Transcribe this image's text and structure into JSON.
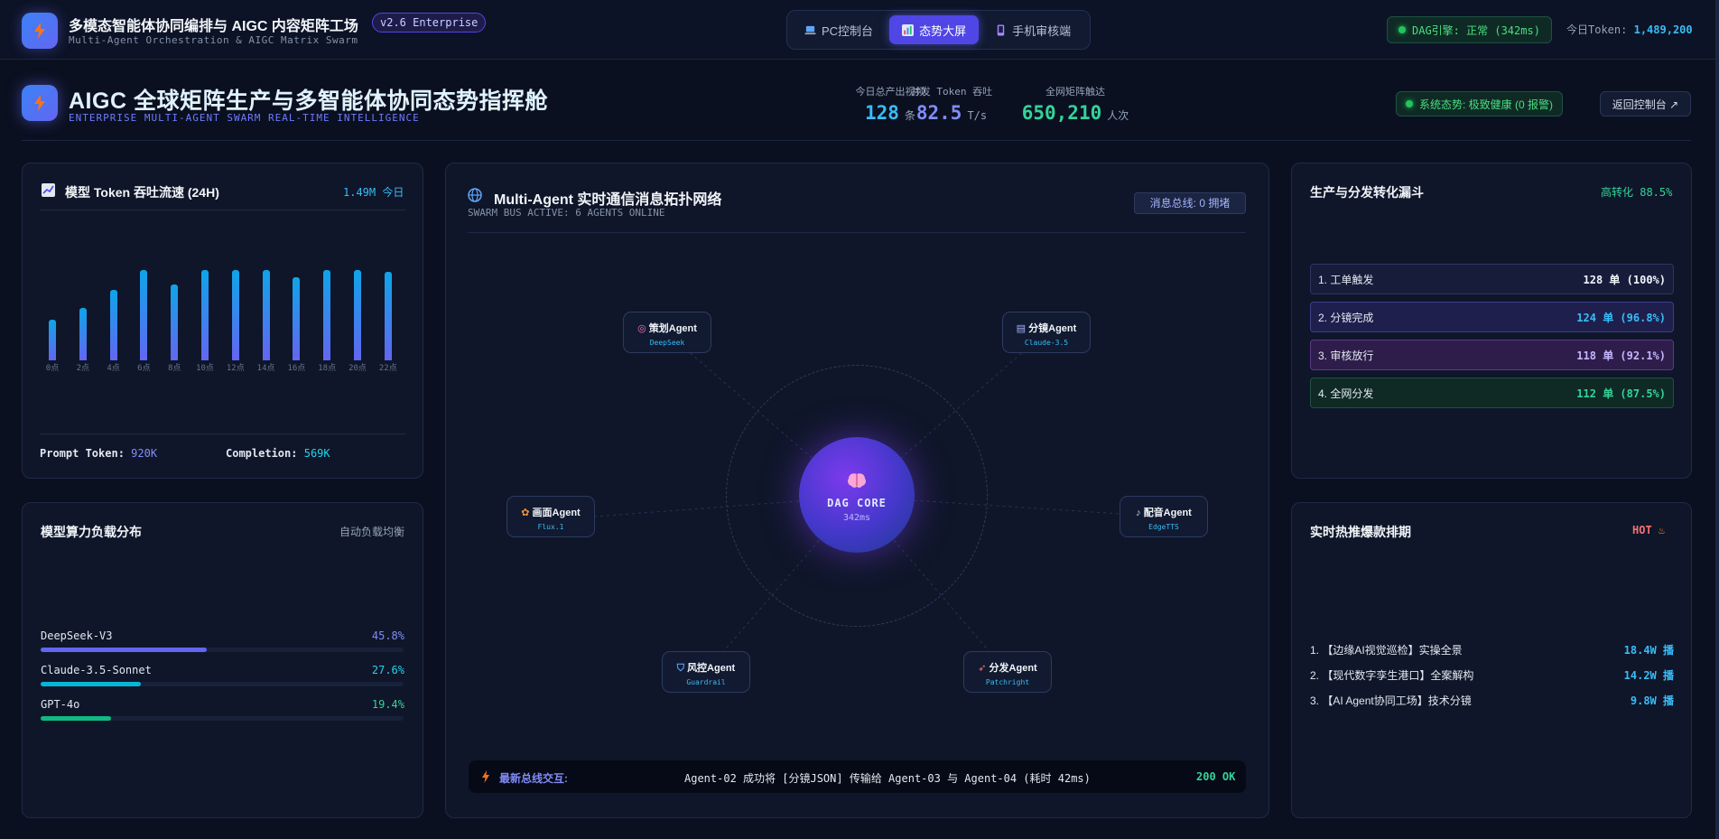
{
  "topbar": {
    "title": "多模态智能体协同编排与 AIGC 内容矩阵工场",
    "subtitle": "Multi-Agent Orchestration & AIGC Matrix Swarm",
    "version": "v2.6 Enterprise",
    "tabs": [
      {
        "label": "PC控制台",
        "icon": "laptop-icon",
        "active": false
      },
      {
        "label": "态势大屏",
        "icon": "bar-chart-icon",
        "active": true
      },
      {
        "label": "手机审核端",
        "icon": "phone-icon",
        "active": false
      }
    ],
    "dag_status": "DAG引擎: 正常 (342ms)",
    "token_label": "今日Token:",
    "token_value": "1,489,200"
  },
  "header": {
    "title": "AIGC 全球矩阵生产与多智能体协同态势指挥舱",
    "subtitle": "ENTERPRISE MULTI-AGENT SWARM REAL-TIME INTELLIGENCE",
    "kpis": [
      {
        "label": "今日总产出视频",
        "value": "128",
        "unit": "条",
        "color": "#38bdf8"
      },
      {
        "label": "并发 Token 吞吐",
        "value": "82.5",
        "unit": "T/s",
        "color": "#818cf8"
      },
      {
        "label": "全网矩阵触达",
        "value": "650,210",
        "unit": "人次",
        "color": "#34d399"
      }
    ],
    "health": "系统态势: 极致健康 (0 报警)",
    "back_button": "返回控制台 ↗"
  },
  "token_panel": {
    "title": "模型 Token 吞吐流速 (24H)",
    "meta": "1.49M 今日",
    "prompt_label": "Prompt Token:",
    "prompt_value": "920K",
    "completion_label": "Completion:",
    "completion_value": "569K"
  },
  "chart_data": {
    "type": "bar",
    "title": "模型 Token 吞吐流速 (24H)",
    "categories": [
      "0点",
      "2点",
      "4点",
      "6点",
      "8点",
      "10点",
      "12点",
      "14点",
      "16点",
      "18点",
      "20点",
      "22点"
    ],
    "values": [
      45,
      58,
      78,
      100,
      84,
      100,
      100,
      100,
      92,
      100,
      100,
      98
    ],
    "ylim": [
      0,
      100
    ],
    "grid": false,
    "legend": "none"
  },
  "load_panel": {
    "title": "模型算力负载分布",
    "meta": "自动负载均衡",
    "items": [
      {
        "name": "DeepSeek-V3",
        "pct": "45.8%",
        "fraction": 0.458,
        "color": "#6366f1",
        "pct_color": "#818cf8"
      },
      {
        "name": "Claude-3.5-Sonnet",
        "pct": "27.6%",
        "fraction": 0.276,
        "color": "#06b6d4",
        "pct_color": "#22d3ee"
      },
      {
        "name": "GPT-4o",
        "pct": "19.4%",
        "fraction": 0.194,
        "color": "#10b981",
        "pct_color": "#34d399"
      }
    ]
  },
  "topology": {
    "title": "Multi-Agent 实时通信消息拓扑网络",
    "subtitle": "SWARM BUS ACTIVE: 6 AGENTS ONLINE",
    "badge": "消息总线: 0 拥堵",
    "core_title": "DAG CORE",
    "core_latency": "342ms",
    "agents": [
      {
        "name": "策划Agent",
        "model": "DeepSeek",
        "icon": "target-icon"
      },
      {
        "name": "分镜Agent",
        "model": "Claude-3.5",
        "icon": "clipboard-icon"
      },
      {
        "name": "画面Agent",
        "model": "Flux.1",
        "icon": "palette-icon"
      },
      {
        "name": "配音Agent",
        "model": "EdgeTTS",
        "icon": "microphone-icon"
      },
      {
        "name": "风控Agent",
        "model": "Guardrail",
        "icon": "shield-icon"
      },
      {
        "name": "分发Agent",
        "model": "Patchright",
        "icon": "rocket-icon"
      }
    ],
    "bus_label": "最新总线交互:",
    "bus_message": "Agent-02 成功将 [分镜JSON] 传输给 Agent-03 与 Agent-04 (耗时 42ms)",
    "bus_status": "200 OK"
  },
  "funnel": {
    "title": "生产与分发转化漏斗",
    "meta": "高转化 88.5%",
    "steps": [
      {
        "label": "1. 工单触发",
        "value": "128 单 (100%)"
      },
      {
        "label": "2. 分镜完成",
        "value": "124 单 (96.8%)"
      },
      {
        "label": "3. 审核放行",
        "value": "118 单 (92.1%)"
      },
      {
        "label": "4. 全网分发",
        "value": "112 单 (87.5%)"
      }
    ]
  },
  "hot": {
    "title": "实时热推爆款排期",
    "meta": "HOT",
    "items": [
      {
        "title": "1. 【边缘AI视觉巡检】实操全景",
        "value": "18.4W 播"
      },
      {
        "title": "2. 【现代数字孪生港口】全案解构",
        "value": "14.2W 播"
      },
      {
        "title": "3. 【AI Agent协同工场】技术分镜",
        "value": "9.8W 播"
      }
    ]
  }
}
